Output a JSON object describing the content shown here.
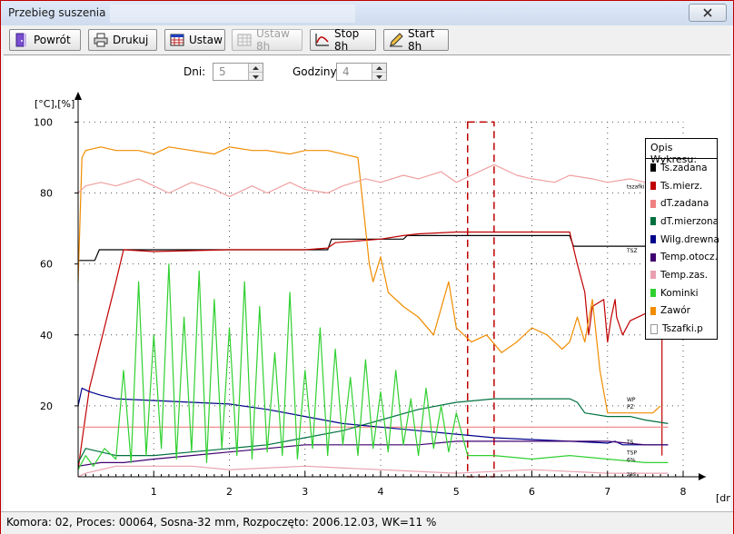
{
  "window": {
    "title": "Przebieg suszenia"
  },
  "toolbar": {
    "buttons": [
      {
        "id": "powrot",
        "label": "Powrót",
        "icon": "exit-door-icon",
        "enabled": true
      },
      {
        "id": "drukuj",
        "label": "Drukuj",
        "icon": "printer-icon",
        "enabled": true
      },
      {
        "id": "ustaw",
        "label": "Ustaw",
        "icon": "grid-table-icon",
        "enabled": true
      },
      {
        "id": "ustaw8h",
        "label": "Ustaw 8h",
        "icon": "grid-clock-icon",
        "enabled": false
      },
      {
        "id": "stop8h",
        "label": "Stop 8h",
        "icon": "curve-stop-icon",
        "enabled": true
      },
      {
        "id": "start8h",
        "label": "Start 8h",
        "icon": "pencil-start-icon",
        "enabled": true
      }
    ]
  },
  "controls": {
    "days_label": "Dni:",
    "days_value": "5",
    "hours_label": "Godziny:",
    "hours_value": "4"
  },
  "legend": {
    "title": "Opis Wykresu:",
    "items": [
      {
        "label": "Ts.zadana",
        "color": "#000000"
      },
      {
        "label": "Ts.mierz.",
        "color": "#c00000"
      },
      {
        "label": "dT.zadana",
        "color": "#f08080"
      },
      {
        "label": "dT.mierzona",
        "color": "#007040"
      },
      {
        "label": "Wilg.drewna",
        "color": "#00008b"
      },
      {
        "label": "Temp.otocz.",
        "color": "#400070"
      },
      {
        "label": "Temp.zas.",
        "color": "#e8a0b0"
      },
      {
        "label": "Kominki",
        "color": "#30d030"
      },
      {
        "label": "Zawór",
        "color": "#f08c00"
      },
      {
        "label": "Tszafki.p",
        "color": "#ffffff"
      }
    ]
  },
  "chart_data": {
    "type": "line",
    "ylabel": "[°C],[%]",
    "xlabel": "[dni]",
    "xlim": [
      0,
      8.3
    ],
    "ylim": [
      0,
      106
    ],
    "x_ticks": [
      1,
      2,
      3,
      4,
      5,
      6,
      7,
      8
    ],
    "y_ticks": [
      20,
      40,
      60,
      80,
      100
    ],
    "grid": true,
    "grid_style": "dotted",
    "marker_band": {
      "x_start": 5.15,
      "x_end": 5.5,
      "color": "#c00000",
      "style": "dashed"
    },
    "right_labels": [
      {
        "text": "tszafki",
        "y": 82
      },
      {
        "text": "TSZ",
        "y": 64
      },
      {
        "text": "WP",
        "y": 22
      },
      {
        "text": "PZ",
        "y": 20
      },
      {
        "text": "TS",
        "y": 10
      },
      {
        "text": "TSP",
        "y": 7
      },
      {
        "text": "6%",
        "y": 5
      },
      {
        "text": "zas",
        "y": 1
      }
    ],
    "series": [
      {
        "name": "Ts.zadana",
        "color": "#000000",
        "x": [
          0,
          0.22,
          0.28,
          1.0,
          2.0,
          3.3,
          3.35,
          4.3,
          4.35,
          6.5,
          6.55,
          7.8
        ],
        "y": [
          61,
          61,
          64,
          64,
          64,
          64,
          67,
          67,
          68,
          68,
          65,
          65
        ]
      },
      {
        "name": "Ts.mierz.",
        "color": "#c00000",
        "x": [
          0,
          0.05,
          0.15,
          0.3,
          0.5,
          0.6,
          1.0,
          2.0,
          3.0,
          3.3,
          3.4,
          4.0,
          4.3,
          4.5,
          5.0,
          6.0,
          6.5,
          6.6,
          6.7,
          6.75,
          6.8,
          6.95,
          7.0,
          7.05,
          7.1,
          7.12,
          7.2,
          7.3,
          7.5,
          7.6,
          7.7,
          7.72,
          7.72
        ],
        "y": [
          2,
          10,
          25,
          38,
          55,
          64,
          63.5,
          64,
          64,
          64.5,
          66,
          67,
          68,
          68.5,
          69,
          69,
          69,
          60,
          52,
          40,
          48,
          50,
          38,
          45,
          50,
          45,
          40,
          44,
          46,
          46,
          46,
          46,
          6
        ]
      },
      {
        "name": "dT.zadana",
        "color": "#f08080",
        "x": [
          0,
          0.1,
          1.0,
          2.0,
          3.0,
          4.0,
          5.0,
          6.0,
          7.0,
          7.8
        ],
        "y": [
          14,
          14,
          14,
          14,
          14,
          14,
          14,
          14,
          14,
          14
        ]
      },
      {
        "name": "dT.mierzona",
        "color": "#007040",
        "x": [
          0,
          0.1,
          0.3,
          0.5,
          1.0,
          1.5,
          2.0,
          2.5,
          3.0,
          3.5,
          4.0,
          4.5,
          5.0,
          5.5,
          6.0,
          6.5,
          6.6,
          6.7,
          7.0,
          7.3,
          7.5,
          7.8
        ],
        "y": [
          4,
          8,
          7,
          6,
          6,
          7,
          8,
          9,
          11,
          13,
          16,
          19,
          21,
          22,
          22,
          22,
          21,
          18,
          17,
          17,
          16,
          15
        ]
      },
      {
        "name": "Wilg.drewna",
        "color": "#00008b",
        "x": [
          0,
          0.05,
          0.15,
          0.3,
          0.5,
          1.0,
          1.5,
          2.0,
          2.5,
          3.0,
          3.5,
          4.0,
          4.5,
          5.0,
          5.5,
          6.0,
          6.5,
          7.0,
          7.1,
          7.2,
          7.8
        ],
        "y": [
          20,
          25,
          24,
          23,
          22,
          21.5,
          21,
          20.5,
          19,
          17,
          15,
          14,
          13,
          12,
          11,
          10.5,
          10,
          9.5,
          10,
          9,
          9
        ]
      },
      {
        "name": "Temp.otocz.",
        "color": "#400070",
        "x": [
          0,
          0.3,
          0.6,
          1.0,
          1.5,
          2.0,
          2.5,
          3.0,
          3.5,
          4.0,
          4.5,
          5.0,
          5.5,
          6.0,
          6.5,
          7.0,
          7.5,
          7.8
        ],
        "y": [
          3,
          4,
          4,
          5,
          6,
          7,
          8,
          9,
          9,
          9,
          9,
          10,
          10,
          10,
          10,
          10,
          9,
          9
        ]
      },
      {
        "name": "Temp.zas.",
        "color": "#e8a0b0",
        "x": [
          0,
          0.1,
          0.3,
          0.5,
          0.8,
          1.0,
          1.5,
          2.0,
          3.0,
          4.0,
          5.0,
          6.0,
          7.0,
          7.5,
          7.8
        ],
        "y": [
          0,
          1,
          2,
          3,
          3,
          3,
          3,
          2,
          3,
          2,
          1,
          2,
          1,
          1,
          1
        ]
      },
      {
        "name": "Kominki",
        "color": "#30d030",
        "x": [
          0,
          0.1,
          0.2,
          0.35,
          0.5,
          0.6,
          0.7,
          0.8,
          0.9,
          1.0,
          1.1,
          1.2,
          1.3,
          1.4,
          1.5,
          1.6,
          1.7,
          1.8,
          1.9,
          2.0,
          2.1,
          2.2,
          2.3,
          2.4,
          2.5,
          2.6,
          2.7,
          2.8,
          2.9,
          3.0,
          3.1,
          3.2,
          3.3,
          3.4,
          3.5,
          3.6,
          3.7,
          3.8,
          3.9,
          4.0,
          4.1,
          4.2,
          4.3,
          4.4,
          4.5,
          4.6,
          4.7,
          4.8,
          4.9,
          5.0,
          5.15,
          5.5,
          6.0,
          6.5,
          7.0,
          7.5,
          7.8
        ],
        "y": [
          2,
          6,
          3,
          8,
          5,
          30,
          4,
          55,
          6,
          40,
          8,
          60,
          5,
          45,
          7,
          58,
          4,
          50,
          8,
          42,
          6,
          55,
          5,
          48,
          7,
          35,
          6,
          52,
          5,
          30,
          8,
          42,
          6,
          36,
          9,
          28,
          6,
          33,
          8,
          24,
          7,
          30,
          9,
          22,
          6,
          25,
          8,
          20,
          7,
          18,
          6,
          6,
          5,
          6,
          5,
          4,
          4
        ]
      },
      {
        "name": "Zawór",
        "color": "#f08c00",
        "x": [
          0,
          0.05,
          0.1,
          0.3,
          0.5,
          0.8,
          1.0,
          1.2,
          1.5,
          1.8,
          2.0,
          2.3,
          2.5,
          2.8,
          3.0,
          3.3,
          3.5,
          3.7,
          3.8,
          3.85,
          3.9,
          4.0,
          4.1,
          4.3,
          4.5,
          4.7,
          4.9,
          5.0,
          5.2,
          5.4,
          5.6,
          5.8,
          6.0,
          6.2,
          6.4,
          6.5,
          6.6,
          6.7,
          6.8,
          6.9,
          7.0,
          7.2,
          7.4,
          7.6,
          7.7
        ],
        "y": [
          55,
          90,
          92,
          93,
          92,
          92,
          91,
          93,
          92,
          91,
          93,
          92,
          92,
          91,
          92,
          92,
          91,
          90,
          70,
          60,
          55,
          62,
          52,
          48,
          45,
          40,
          55,
          42,
          38,
          40,
          35,
          38,
          42,
          40,
          36,
          38,
          45,
          38,
          50,
          30,
          18,
          18,
          18,
          18,
          20
        ]
      },
      {
        "name": "Tszafki.p",
        "color": "#f0a0a0",
        "x": [
          0,
          0.1,
          0.3,
          0.5,
          0.8,
          1.0,
          1.2,
          1.5,
          1.8,
          2.0,
          2.3,
          2.5,
          2.8,
          3.0,
          3.3,
          3.5,
          3.8,
          4.0,
          4.3,
          4.5,
          4.8,
          5.0,
          5.3,
          5.5,
          5.8,
          6.0,
          6.3,
          6.5,
          6.8,
          7.0,
          7.3,
          7.5,
          7.8
        ],
        "y": [
          80,
          82,
          83,
          82,
          84,
          82,
          80,
          83,
          81,
          79,
          82,
          80,
          83,
          81,
          80,
          82,
          84,
          83,
          85,
          84,
          86,
          83,
          86,
          88,
          85,
          84,
          83,
          85,
          84,
          83,
          84,
          83,
          83
        ]
      }
    ]
  },
  "status": {
    "text": "Komora: 02,  Proces: 00064,  Sosna-32 mm,  Rozpoczęto: 2006.12.03,  WK=11 %"
  }
}
